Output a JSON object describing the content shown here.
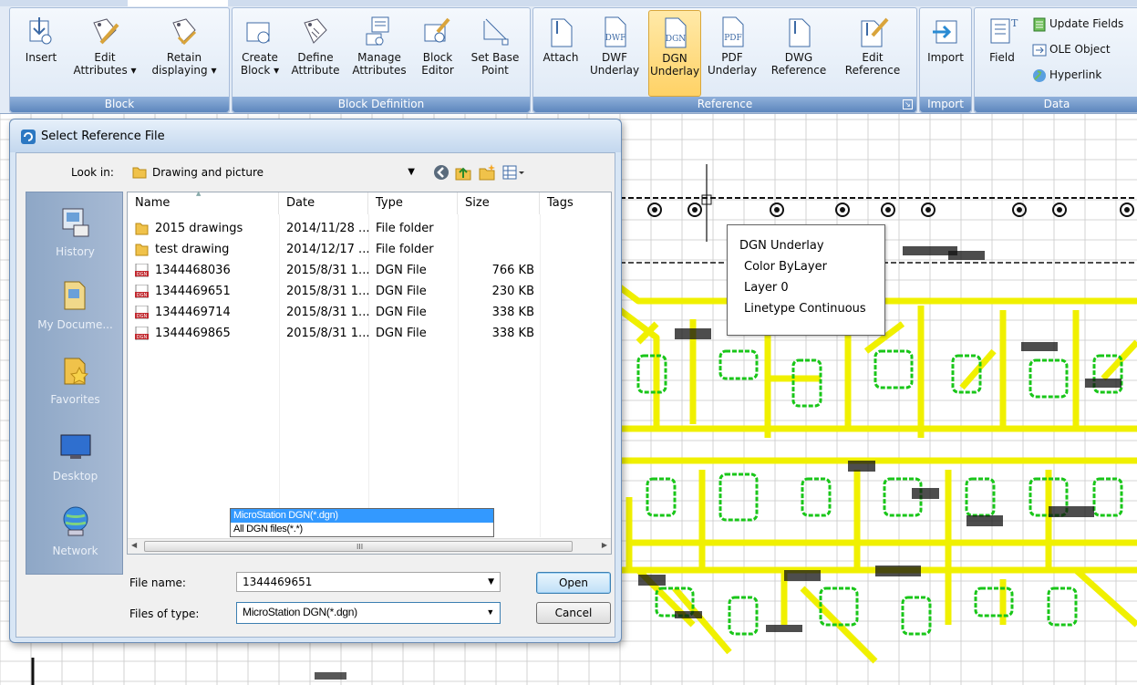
{
  "ribbon": {
    "panels": [
      {
        "label": "Block",
        "buttons": [
          {
            "label": "Insert",
            "icon": "insert-block-icon"
          },
          {
            "label": "Edit Attributes ▾",
            "icon": "edit-attributes-icon"
          },
          {
            "label": "Retain displaying ▾",
            "icon": "retain-displaying-icon"
          }
        ]
      },
      {
        "label": "Block Definition",
        "buttons": [
          {
            "label": "Create Block ▾",
            "icon": "create-block-icon"
          },
          {
            "label": "Define Attribute",
            "icon": "define-attribute-icon"
          },
          {
            "label": "Manage Attributes",
            "icon": "manage-attributes-icon"
          },
          {
            "label": "Block Editor",
            "icon": "block-editor-icon"
          },
          {
            "label": "Set Base Point",
            "icon": "set-base-point-icon"
          }
        ]
      },
      {
        "label": "Reference",
        "buttons": [
          {
            "label": "Attach",
            "icon": "attach-icon"
          },
          {
            "label": "DWF Underlay",
            "icon": "dwf-underlay-icon"
          },
          {
            "label": "DGN Underlay",
            "icon": "dgn-underlay-icon"
          },
          {
            "label": "PDF Underlay",
            "icon": "pdf-underlay-icon"
          },
          {
            "label": "DWG Reference",
            "icon": "dwg-reference-icon"
          },
          {
            "label": "Edit Reference",
            "icon": "edit-reference-icon"
          }
        ]
      },
      {
        "label": "Import",
        "buttons": [
          {
            "label": "Import",
            "icon": "import-icon"
          }
        ]
      },
      {
        "label": "Data",
        "buttons": [
          {
            "label": "Field",
            "icon": "field-icon"
          }
        ],
        "small_buttons": [
          {
            "label": "Update Fields",
            "icon": "update-fields-icon"
          },
          {
            "label": "OLE Object",
            "icon": "ole-object-icon"
          },
          {
            "label": "Hyperlink",
            "icon": "hyperlink-icon"
          }
        ]
      }
    ],
    "icon_texts": {
      "dwf": "DWF",
      "dgn": "DGN",
      "pdf": "PDF"
    },
    "accent": "#ffd266"
  },
  "dialog": {
    "title": "Select Reference File",
    "look_in_label": "Look in:",
    "look_in_value": "Drawing and picture",
    "places": [
      "History",
      "My Docume...",
      "Favorites",
      "Desktop",
      "Network"
    ],
    "columns": [
      "Name",
      "Date",
      "Type",
      "Size",
      "Tags"
    ],
    "files": [
      {
        "name": "2015 drawings",
        "date": "2014/11/28 ...",
        "type": "File folder",
        "size": "",
        "kind": "folder"
      },
      {
        "name": "test drawing",
        "date": "2014/12/17 ...",
        "type": "File folder",
        "size": "",
        "kind": "folder"
      },
      {
        "name": "1344468036",
        "date": "2015/8/31 1...",
        "type": "DGN File",
        "size": "766 KB",
        "kind": "dgn"
      },
      {
        "name": "1344469651",
        "date": "2015/8/31 1...",
        "type": "DGN File",
        "size": "230 KB",
        "kind": "dgn"
      },
      {
        "name": "1344469714",
        "date": "2015/8/31 1...",
        "type": "DGN File",
        "size": "338 KB",
        "kind": "dgn"
      },
      {
        "name": "1344469865",
        "date": "2015/8/31 1...",
        "type": "DGN File",
        "size": "338 KB",
        "kind": "dgn"
      }
    ],
    "file_name_label": "File name:",
    "file_name_value": "1344469651",
    "files_of_type_label": "Files of type:",
    "files_of_type_value": "MicroStation DGN(*.dgn)",
    "type_options": [
      "MicroStation DGN(*.dgn)",
      "All DGN files(*.*)"
    ],
    "open_label": "Open",
    "cancel_label": "Cancel",
    "dgn_icon_text": "DGN",
    "scroll_grip": "III"
  },
  "tooltip": {
    "title": "DGN Underlay",
    "rows": [
      "Color  ByLayer",
      "Layer  0",
      "Linetype  Continuous"
    ]
  },
  "drawing": {
    "colors": {
      "walls": "#f0f000",
      "fixtures": "#19c619",
      "grid": "#c8c8c8",
      "dark": "#111111"
    }
  }
}
